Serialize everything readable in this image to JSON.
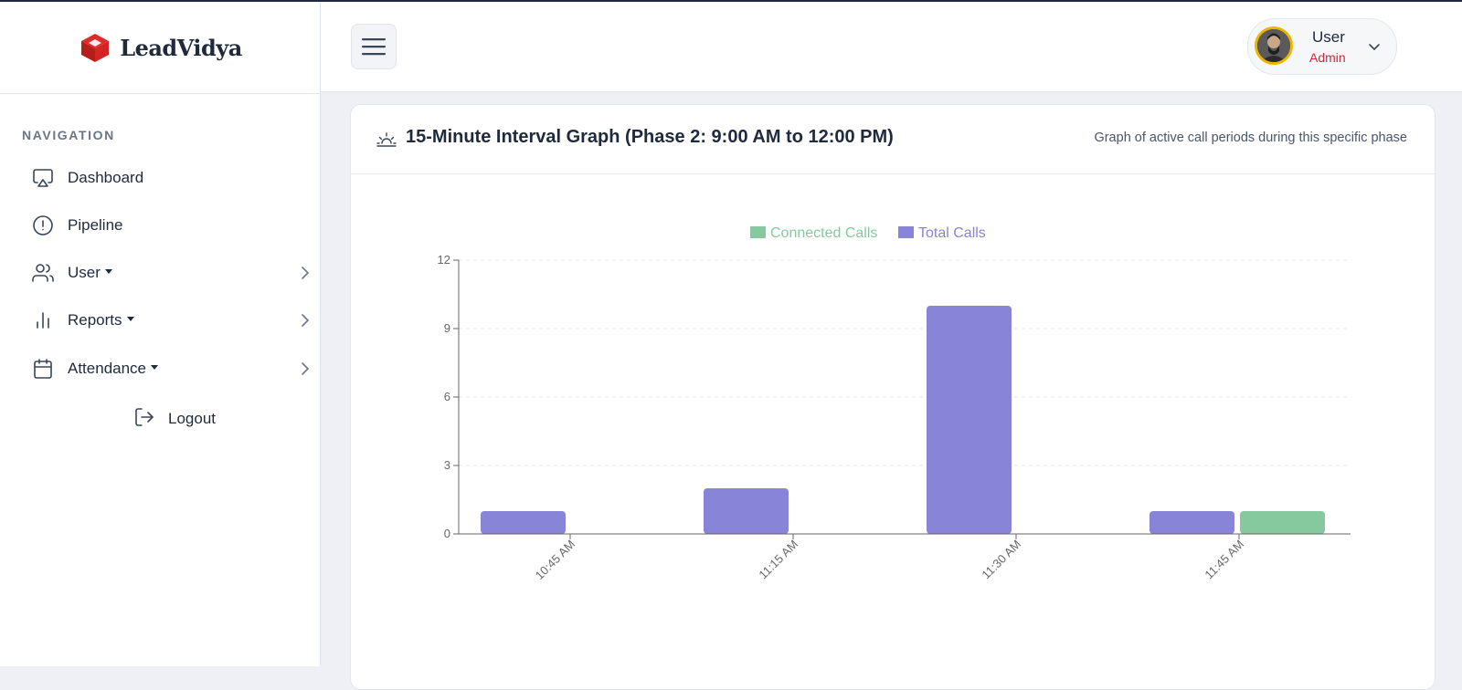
{
  "brand": {
    "name": "LeadVidya"
  },
  "sidebar": {
    "heading": "NAVIGATION",
    "items": [
      {
        "label": "Dashboard",
        "icon": "monitor-icon",
        "dropdown": false
      },
      {
        "label": "Pipeline",
        "icon": "alert-circle-icon",
        "dropdown": false
      },
      {
        "label": "User",
        "icon": "users-icon",
        "dropdown": true
      },
      {
        "label": "Reports",
        "icon": "bar-chart-icon",
        "dropdown": true
      },
      {
        "label": "Attendance",
        "icon": "calendar-icon",
        "dropdown": true
      }
    ],
    "logout": {
      "label": "Logout",
      "icon": "logout-icon"
    }
  },
  "header": {
    "user": {
      "name": "User",
      "role": "Admin"
    }
  },
  "card": {
    "title": "15-Minute Interval Graph (Phase 2: 9:00 AM to 12:00 PM)",
    "subtitle": "Graph of active call periods during this specific phase",
    "icon": "sunrise-icon"
  },
  "colors": {
    "accent_red": "#d6283e",
    "connected": "#86c99f",
    "total": "#8884d8"
  },
  "chart_data": {
    "type": "bar",
    "categories": [
      "10:45 AM",
      "11:15 AM",
      "11:30 AM",
      "11:45 AM"
    ],
    "series": [
      {
        "name": "Total Calls",
        "color": "#8884d8",
        "values": [
          1,
          2,
          10,
          1
        ]
      },
      {
        "name": "Connected Calls",
        "color": "#86c99f",
        "values": [
          0,
          0,
          0,
          1
        ]
      }
    ],
    "legend": [
      "Connected Calls",
      "Total Calls"
    ],
    "legend_position": "top-center",
    "yticks": [
      0,
      3,
      6,
      9,
      12
    ],
    "ylim": [
      0,
      12
    ],
    "grid": true
  }
}
